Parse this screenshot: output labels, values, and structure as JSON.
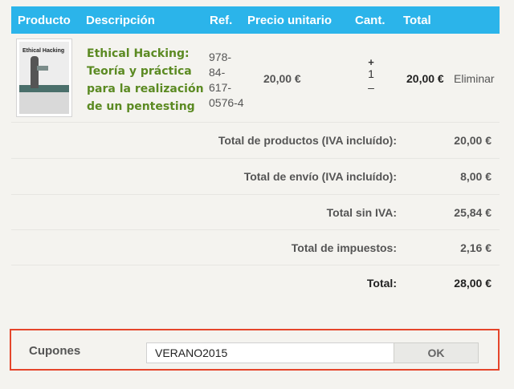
{
  "table": {
    "headers": [
      "Producto",
      "Descripción",
      "Ref.",
      "Precio unitario",
      "Cant.",
      "Total"
    ]
  },
  "product": {
    "cover_title": "Ethical Hacking",
    "description": "Ethical Hacking: Teoría y práctica para la realización de un pentesting",
    "reference": "978-84-617-0576-4",
    "unit_price": "20,00 €",
    "quantity": "1",
    "increment_symbol": "+",
    "decrement_symbol": "–",
    "total": "20,00 €",
    "remove_label": "Eliminar"
  },
  "totals": [
    {
      "label": "Total de productos (IVA incluído):",
      "amount": "20,00 €"
    },
    {
      "label": "Total de envío (IVA incluído):",
      "amount": "8,00 €"
    },
    {
      "label": "Total sin IVA:",
      "amount": "25,84 €"
    },
    {
      "label": "Total de impuestos:",
      "amount": "2,16 €"
    },
    {
      "label": "Total:",
      "amount": "28,00 €"
    }
  ],
  "coupon": {
    "label": "Cupones",
    "value": "VERANO2015",
    "button_label": "OK"
  },
  "colors": {
    "header": "#2bb4ea",
    "product_link": "#5b8a22",
    "highlight_border": "#e5452b"
  }
}
